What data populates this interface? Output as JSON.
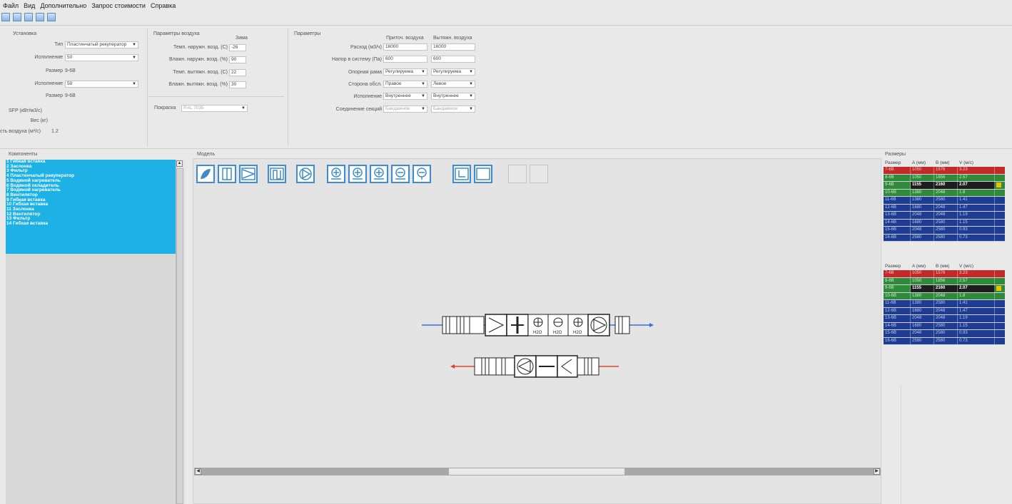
{
  "menu": [
    "Файл",
    "Вид",
    "Дополнительно",
    "Запрос стоимости",
    "Справка"
  ],
  "toolbar_icons": [
    "new-icon",
    "open-icon",
    "save-icon",
    "print-icon",
    "help-icon"
  ],
  "installation": {
    "title": "Установка",
    "type_label": "Тип",
    "type_value": "Пластинчатый рекуператор",
    "section1_label": "Исполнение",
    "section1_value": "50",
    "size1_label": "Размер",
    "size1_value": "9-6В",
    "section2_label": "Исполнение",
    "section2_value": "50",
    "size2_label": "Размер",
    "size2_value": "9-6В",
    "sfp_label": "SFP (кВт/м3/с)",
    "weight_label": "Вес (кг)",
    "velocity_label": "сть воздуха (м³/с)",
    "velocity_value": "1.2"
  },
  "air_params": {
    "title": "Параметры воздуха",
    "season_header": "Зима",
    "rows": [
      {
        "label": "Темп. наружн. возд. (С)",
        "value": "-26"
      },
      {
        "label": "Влажн. наружн. возд. (%)",
        "value": "90"
      },
      {
        "label": "Темп. вытяжн. возд. (С)",
        "value": "22"
      },
      {
        "label": "Влажн. вытяжн. возд. (%)",
        "value": "30"
      }
    ],
    "coating_label": "Покраска",
    "coating_value": "RAL 7035"
  },
  "params": {
    "title": "Параметры",
    "col1_header": "Приточ. воздуха",
    "col2_header": "Вытяжн. воздуха",
    "rows": [
      {
        "label": "Расход (м3/ч)",
        "v1": "16000",
        "v2": "16000",
        "kind": "input"
      },
      {
        "label": "Напор в систему (Па)",
        "v1": "600",
        "v2": "600",
        "kind": "input"
      },
      {
        "label": "Опорная рама",
        "v1": "Регулируема",
        "v2": "Регулируема",
        "kind": "select"
      },
      {
        "label": "Сторона обсл.",
        "v1": "Правое",
        "v2": "Левое",
        "kind": "select"
      },
      {
        "label": "Исполнение",
        "v1": "Внутреннее",
        "v2": "Внутреннее",
        "kind": "select"
      },
      {
        "label": "Соединение секций",
        "v1": "Бандажное",
        "v2": "Бандажное",
        "kind": "disabled"
      }
    ]
  },
  "components": {
    "title": "Компоненты",
    "items": [
      "1 Гибкая вставка",
      "2 Заслонка",
      "3 Фильтр",
      "4 Пластинчатый рекуператор",
      "5 Водяной нагреватель",
      "6 Водяной охладитель",
      "7 Водяной нагреватель",
      "8 Вентилятор",
      "9 Гибкая вставка",
      "10 Гибкая вставка",
      "11 Заслонка",
      "12 Вентилятор",
      "13 Фильтр",
      "14 Гибкая вставка"
    ]
  },
  "model": {
    "title": "Модель",
    "tools": [
      "flexible-insert-icon",
      "damper-icon",
      "filter-icon",
      "heat-recovery-icon",
      "fan-icon",
      "heater-icon",
      "cooler-icon",
      "heater2-icon",
      "humidifier-icon",
      "droplet-eliminator-icon",
      "service-section-icon",
      "empty-section-icon",
      "disabled-tool-1",
      "disabled-tool-2"
    ],
    "coil_label": "H2O"
  },
  "sizes": {
    "title": "Размеры",
    "headers": [
      "Размер",
      "A (мм)",
      "B (мм)",
      "V (м/с)"
    ],
    "table1": [
      {
        "size": "7-6В",
        "a": "1050",
        "b": "1576",
        "v": "3.23",
        "color": "red"
      },
      {
        "size": "8-6В",
        "a": "1050",
        "b": "1856",
        "v": "2.57",
        "color": "green"
      },
      {
        "size": "9-6В",
        "a": "1155",
        "b": "2160",
        "v": "2.07",
        "color": "dark"
      },
      {
        "size": "10-6В",
        "a": "1380",
        "b": "2048",
        "v": "1.8",
        "color": "green"
      },
      {
        "size": "11-6В",
        "a": "1380",
        "b": "2580",
        "v": "1.41",
        "color": "blue"
      },
      {
        "size": "12-6В",
        "a": "1680",
        "b": "2048",
        "v": "1.47",
        "color": "blue"
      },
      {
        "size": "13-6В",
        "a": "2048",
        "b": "2048",
        "v": "1.19",
        "color": "blue"
      },
      {
        "size": "14-6В",
        "a": "1680",
        "b": "2580",
        "v": "1.15",
        "color": "blue"
      },
      {
        "size": "15-6В",
        "a": "2048",
        "b": "2580",
        "v": "0.93",
        "color": "blue"
      },
      {
        "size": "16-6В",
        "a": "2580",
        "b": "2580",
        "v": "0.73",
        "color": "blue"
      }
    ],
    "table2": [
      {
        "size": "7-6В",
        "a": "1050",
        "b": "1576",
        "v": "3.23",
        "color": "red"
      },
      {
        "size": "8-6В",
        "a": "1050",
        "b": "1856",
        "v": "2.57",
        "color": "green"
      },
      {
        "size": "9-6В",
        "a": "1155",
        "b": "2160",
        "v": "2.07",
        "color": "dark"
      },
      {
        "size": "10-6В",
        "a": "1380",
        "b": "2048",
        "v": "1.8",
        "color": "green"
      },
      {
        "size": "11-6В",
        "a": "1380",
        "b": "2580",
        "v": "1.41",
        "color": "blue"
      },
      {
        "size": "12-6В",
        "a": "1680",
        "b": "2048",
        "v": "1.47",
        "color": "blue"
      },
      {
        "size": "13-6В",
        "a": "2048",
        "b": "2048",
        "v": "1.19",
        "color": "blue"
      },
      {
        "size": "14-6В",
        "a": "1680",
        "b": "2580",
        "v": "1.15",
        "color": "blue"
      },
      {
        "size": "15-6В",
        "a": "2048",
        "b": "2580",
        "v": "0.93",
        "color": "blue"
      },
      {
        "size": "16-6В",
        "a": "2580",
        "b": "2580",
        "v": "0.73",
        "color": "blue"
      }
    ]
  },
  "colors": {
    "accent": "#3e8ccf",
    "list_bg": "#1eb1e6",
    "supply": "#3a6fd8",
    "exhaust": "#e0452a"
  }
}
